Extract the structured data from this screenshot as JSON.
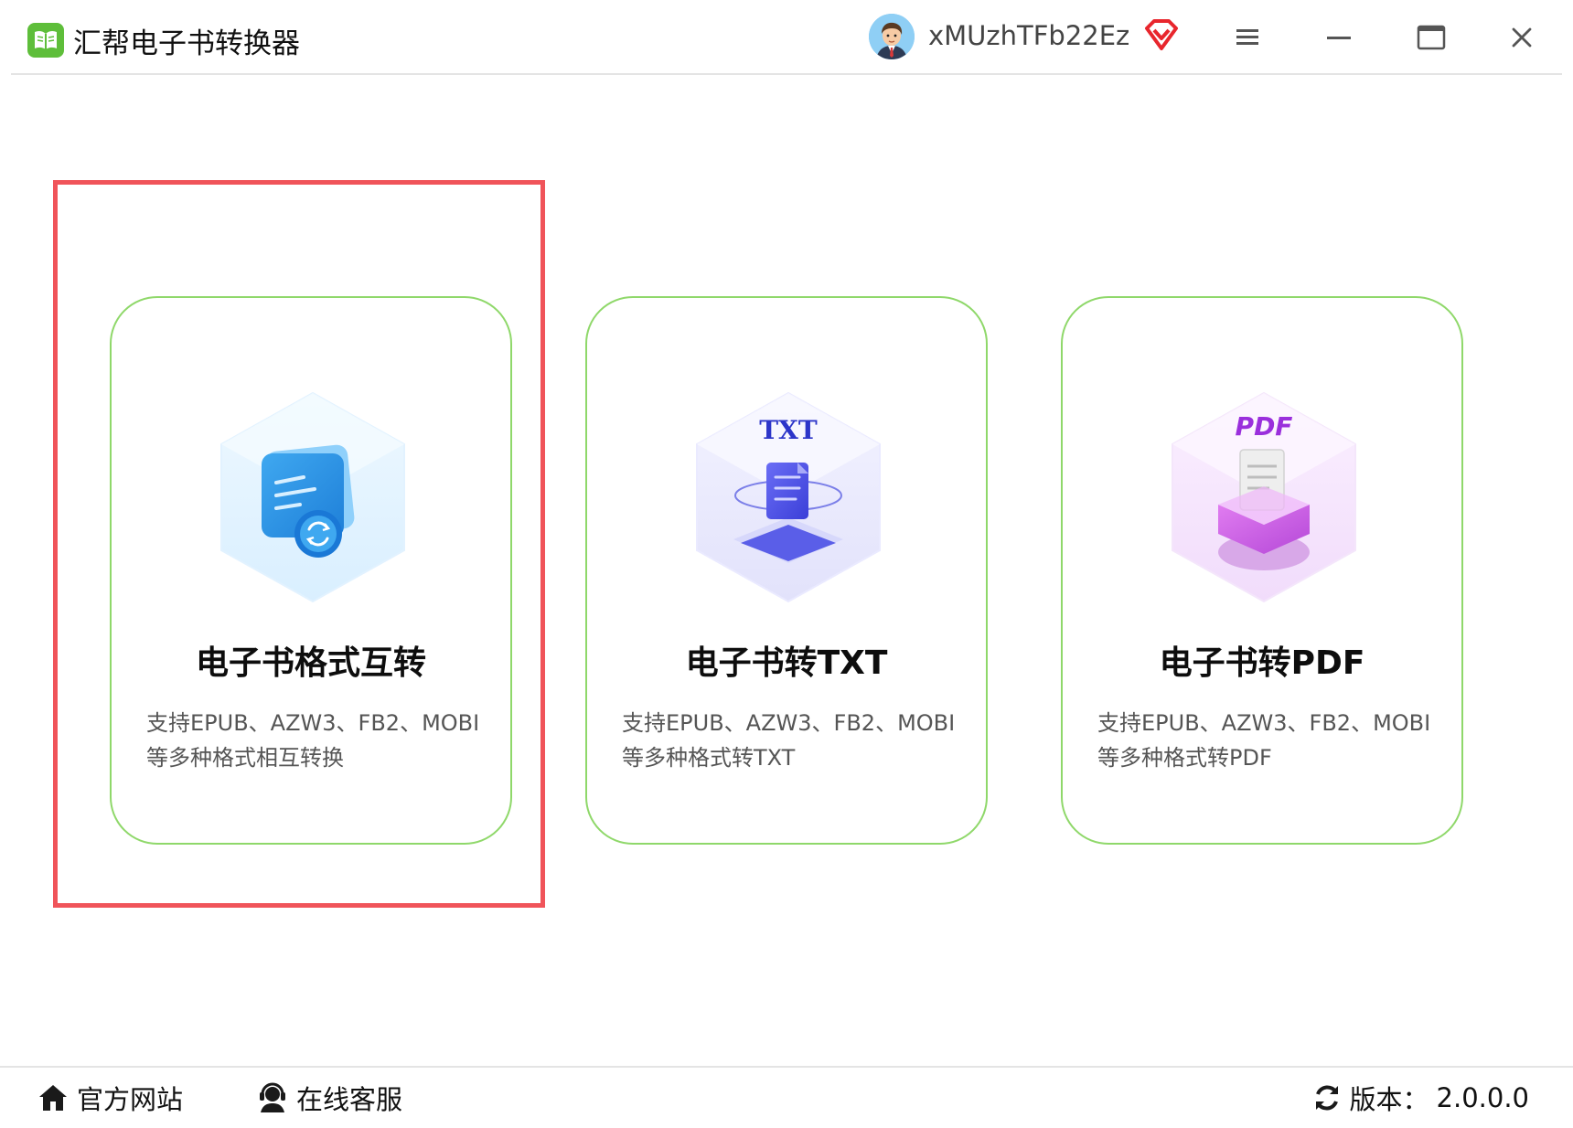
{
  "app": {
    "title": "汇帮电子书转换器",
    "icon": "book-icon",
    "brand_color": "#5ebe3a"
  },
  "user": {
    "name": "xMUzhTFb22Ez",
    "avatar": "user-avatar",
    "vip_icon": "vip-diamond-icon"
  },
  "window_controls": {
    "menu": "menu-icon",
    "minimize": "minimize-icon",
    "maximize": "maximize-icon",
    "close": "close-icon"
  },
  "cards": [
    {
      "title": "电子书格式互转",
      "desc_line1": "支持EPUB、AZW3、FB2、MOBI",
      "desc_line2": "等多种格式相互转换",
      "icon": "format-convert-icon",
      "selected": true
    },
    {
      "title": "电子书转TXT",
      "desc_line1": "支持EPUB、AZW3、FB2、MOBI",
      "desc_line2": "等多种格式转TXT",
      "icon": "txt-convert-icon",
      "badge": "TXT"
    },
    {
      "title": "电子书转PDF",
      "desc_line1": "支持EPUB、AZW3、FB2、MOBI",
      "desc_line2": "等多种格式转PDF",
      "icon": "pdf-convert-icon",
      "badge": "PDF"
    }
  ],
  "footer": {
    "website_label": "官方网站",
    "support_label": "在线客服",
    "version_prefix": "版本：",
    "version_value": "2.0.0.0"
  },
  "colors": {
    "card_border": "#8fd86a",
    "selection": "#f0545a",
    "vip": "#e8262d"
  }
}
